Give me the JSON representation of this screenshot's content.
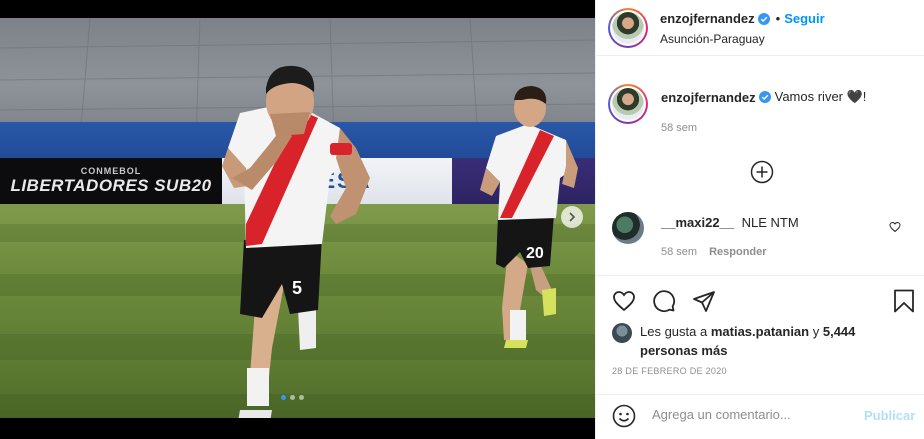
{
  "post": {
    "author": "enzojfernandez",
    "follow_label": "Seguir",
    "separator": "•",
    "location": "Asunción-Paraguay",
    "media": {
      "current_slide": 1,
      "total_slides": 3,
      "ad_left_small": "CONMEBOL",
      "ad_left_big": "LIBERTADORES SUB20",
      "ad_mid": "DESA"
    }
  },
  "caption": {
    "username": "enzojfernandez",
    "text": "Vamos river 🖤!",
    "time": "58 sem"
  },
  "comments": [
    {
      "username": "__maxi22__",
      "text": "NLE NTM",
      "time": "58 sem",
      "reply_label": "Responder"
    }
  ],
  "likes": {
    "prefix": "Les gusta a",
    "user": "matias.patanian",
    "middle": "y",
    "count_text": "5,444 personas más"
  },
  "date": "28 DE FEBRERO DE 2020",
  "composer": {
    "placeholder": "Agrega un comentario...",
    "publish_label": "Publicar"
  },
  "colors": {
    "link": "#0095f6",
    "publish_disabled": "#b2dffc",
    "secondary_text": "#8e8e8e"
  },
  "icons": [
    "verified-badge-icon",
    "next-arrow-icon",
    "add-circle-icon",
    "heart-icon",
    "comment-icon",
    "share-icon",
    "bookmark-icon",
    "emoji-icon"
  ]
}
